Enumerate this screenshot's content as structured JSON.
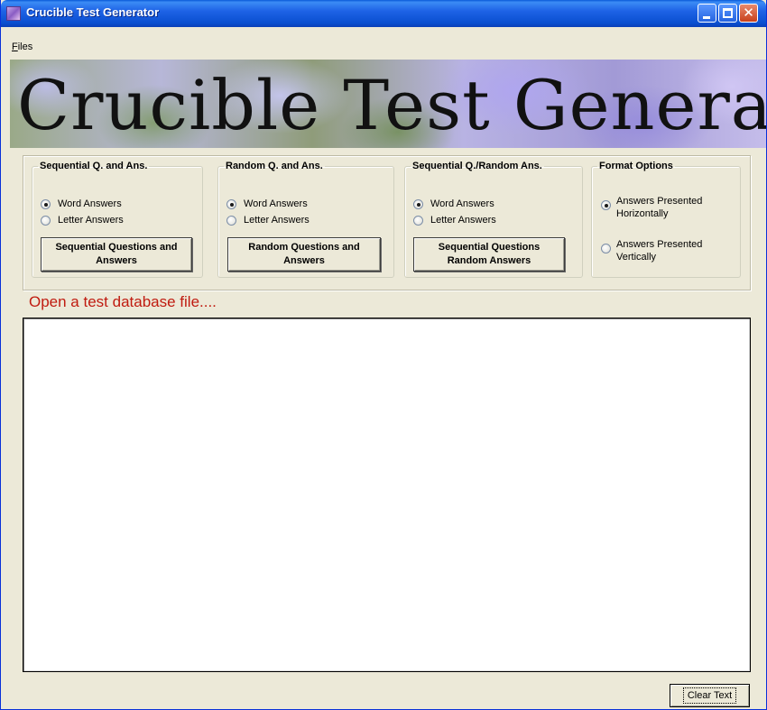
{
  "window": {
    "title": "Crucible Test Generator"
  },
  "menu": {
    "files_label_first": "F",
    "files_label_rest": "iles"
  },
  "banner": {
    "text": "Crucible Test Generator"
  },
  "groups": {
    "sequential": {
      "legend": "Sequential Q. and Ans.",
      "options": [
        "Word Answers",
        "Letter Answers"
      ],
      "selected": "Word Answers",
      "button": "Sequential Questions and Answers"
    },
    "random": {
      "legend": "Random Q. and Ans.",
      "options": [
        "Word Answers",
        "Letter Answers"
      ],
      "selected": "Word Answers",
      "button": "Random Questions and Answers"
    },
    "seq_random": {
      "legend": "Sequential Q./Random Ans.",
      "options": [
        "Word Answers",
        "Letter Answers"
      ],
      "selected": "Word Answers",
      "button": "Sequential Questions Random Answers"
    },
    "format": {
      "legend": "Format Options",
      "options": [
        "Answers Presented Horizontally",
        "Answers Presented Vertically"
      ],
      "selected": "Answers Presented Horizontally"
    }
  },
  "status": {
    "message": "Open a test database file...."
  },
  "output": {
    "text": ""
  },
  "actions": {
    "clear_label": "Clear Text"
  },
  "icons": {
    "app": "crucible-app-icon",
    "minimize": "minimize-icon",
    "maximize": "maximize-icon",
    "close": "close-icon"
  }
}
